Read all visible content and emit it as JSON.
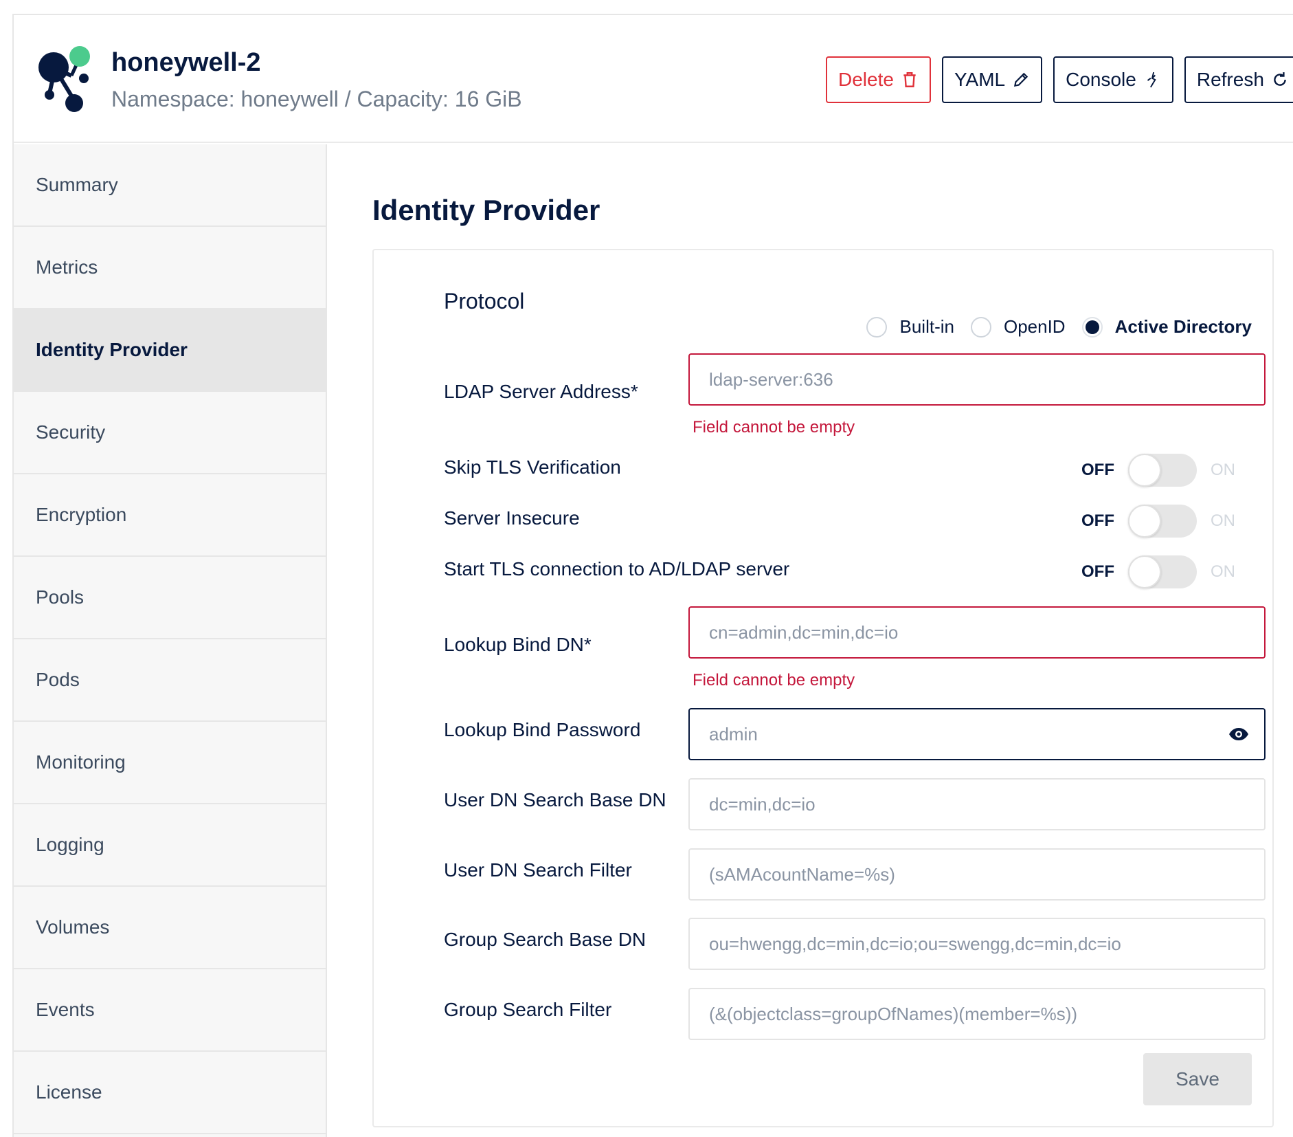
{
  "header": {
    "tenant_name": "honeywell-2",
    "tenant_subtitle": "Namespace: honeywell / Capacity: 16 GiB",
    "buttons": {
      "delete": "Delete",
      "yaml": "YAML",
      "console": "Console",
      "refresh": "Refresh"
    }
  },
  "sidebar": {
    "items": [
      {
        "label": "Summary"
      },
      {
        "label": "Metrics"
      },
      {
        "label": "Identity Provider"
      },
      {
        "label": "Security"
      },
      {
        "label": "Encryption"
      },
      {
        "label": "Pools"
      },
      {
        "label": "Pods"
      },
      {
        "label": "Monitoring"
      },
      {
        "label": "Logging"
      },
      {
        "label": "Volumes"
      },
      {
        "label": "Events"
      },
      {
        "label": "License"
      }
    ],
    "active": "Identity Provider"
  },
  "main": {
    "title": "Identity Provider",
    "protocol": {
      "label": "Protocol",
      "options": [
        "Built-in",
        "OpenID",
        "Active Directory"
      ],
      "selected": "Active Directory"
    },
    "fields": {
      "ldap_server": {
        "label": "LDAP Server Address*",
        "placeholder": "ldap-server:636",
        "error": "Field cannot be empty"
      },
      "lookup_bind_dn": {
        "label": "Lookup Bind DN*",
        "placeholder": "cn=admin,dc=min,dc=io",
        "error": "Field cannot be empty"
      },
      "lookup_bind_password": {
        "label": "Lookup Bind Password",
        "placeholder": "admin"
      },
      "user_dn_search_base": {
        "label": "User DN Search Base DN",
        "placeholder": "dc=min,dc=io"
      },
      "user_dn_search_filter": {
        "label": "User DN Search Filter",
        "placeholder": "(sAMAcountName=%s)"
      },
      "group_search_base": {
        "label": "Group Search Base DN",
        "placeholder": "ou=hwengg,dc=min,dc=io;ou=swengg,dc=min,dc=io"
      },
      "group_search_filter": {
        "label": "Group Search Filter",
        "placeholder": "(&(objectclass=groupOfNames)(member=%s))"
      }
    },
    "toggles": {
      "off_label": "OFF",
      "on_label": "ON",
      "skip_tls": {
        "label": "Skip TLS Verification",
        "value": "OFF"
      },
      "server_insecure": {
        "label": "Server Insecure",
        "value": "OFF"
      },
      "start_tls": {
        "label": "Start TLS connection to AD/LDAP server",
        "value": "OFF"
      }
    },
    "save_label": "Save"
  },
  "colors": {
    "primary": "#07193e",
    "danger": "#e0313a",
    "error": "#c4183c",
    "logo_accent": "#4ccb8d"
  }
}
